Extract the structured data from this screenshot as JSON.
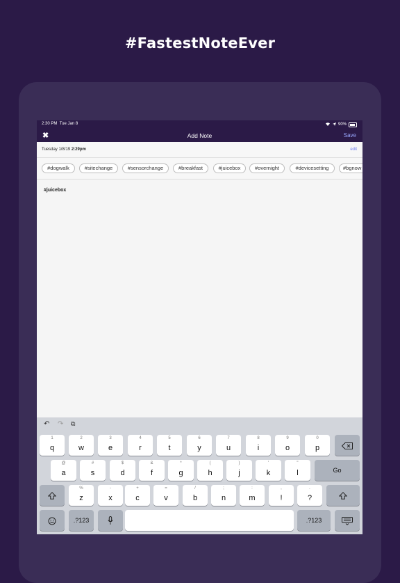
{
  "headline": "#FastestNoteEver",
  "status_bar": {
    "time": "2:30 PM",
    "day": "Tue Jan 8",
    "battery": "90%"
  },
  "nav": {
    "title": "Add Note",
    "save_label": "Save",
    "close_icon": "close-x-icon"
  },
  "date_bar": {
    "date_prefix": "Tuesday 1/8/19",
    "time": "2:29pm",
    "edit_label": "edit"
  },
  "tags": [
    "#dogwalk",
    "#sitechange",
    "#sensorchange",
    "#breakfast",
    "#juicebox",
    "#overnight",
    "#devicesetting",
    "#bgnow"
  ],
  "note": {
    "text": "#juicebox"
  },
  "keyboard": {
    "row1": [
      {
        "main": "q",
        "sub": "1"
      },
      {
        "main": "w",
        "sub": "2"
      },
      {
        "main": "e",
        "sub": "3"
      },
      {
        "main": "r",
        "sub": "4"
      },
      {
        "main": "t",
        "sub": "5"
      },
      {
        "main": "y",
        "sub": "6"
      },
      {
        "main": "u",
        "sub": "7"
      },
      {
        "main": "i",
        "sub": "8"
      },
      {
        "main": "o",
        "sub": "9"
      },
      {
        "main": "p",
        "sub": "0"
      }
    ],
    "row2": [
      {
        "main": "a",
        "sub": "@"
      },
      {
        "main": "s",
        "sub": "#"
      },
      {
        "main": "d",
        "sub": "$"
      },
      {
        "main": "f",
        "sub": "&"
      },
      {
        "main": "g",
        "sub": "*"
      },
      {
        "main": "h",
        "sub": "("
      },
      {
        "main": "j",
        "sub": ")"
      },
      {
        "main": "k",
        "sub": "'"
      },
      {
        "main": "l",
        "sub": "\""
      }
    ],
    "row3": [
      {
        "main": "z",
        "sub": "%"
      },
      {
        "main": "x",
        "sub": "-"
      },
      {
        "main": "c",
        "sub": "+"
      },
      {
        "main": "v",
        "sub": "="
      },
      {
        "main": "b",
        "sub": "/"
      },
      {
        "main": "n",
        "sub": ";"
      },
      {
        "main": "m",
        "sub": ":"
      },
      {
        "main": "!",
        "sub": ","
      },
      {
        "main": "?",
        "sub": "."
      }
    ],
    "go_label": "Go",
    "numbers_label": ".?123"
  }
}
